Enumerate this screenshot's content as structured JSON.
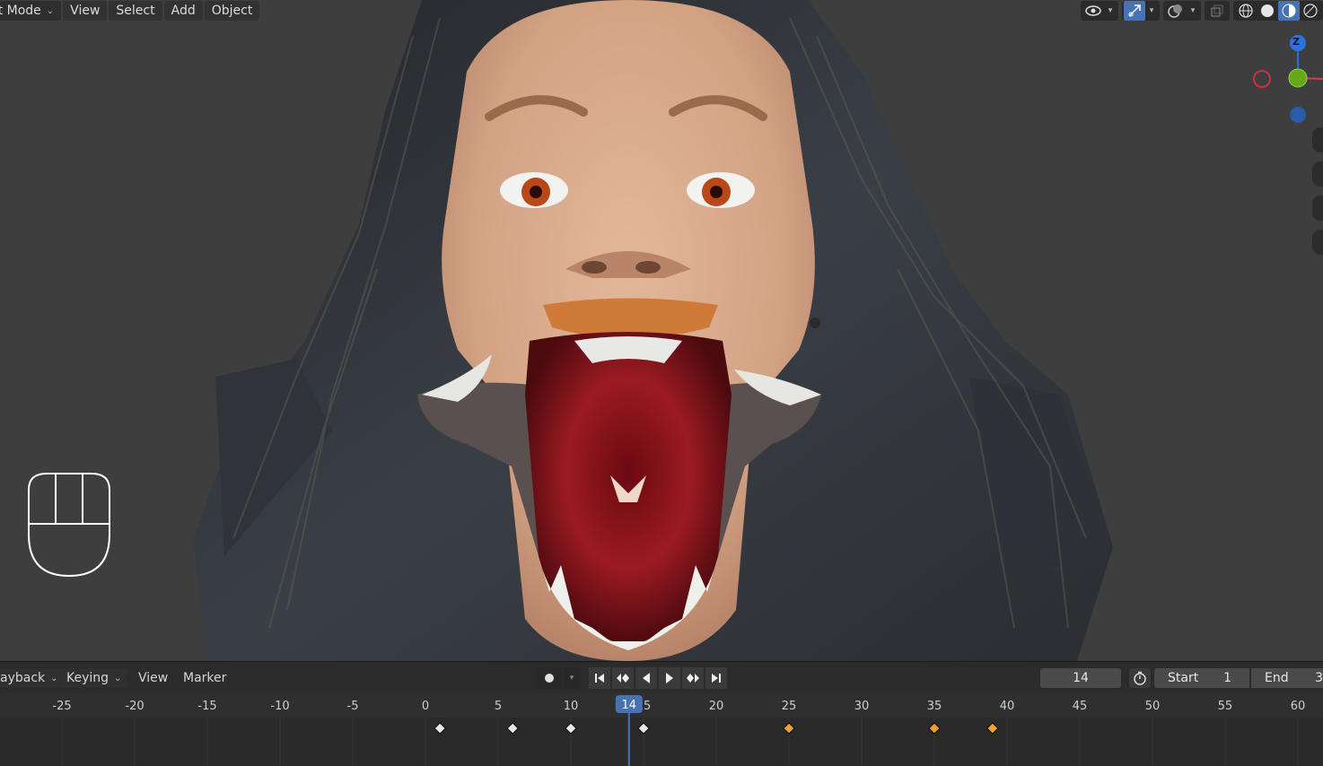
{
  "header": {
    "mode_label": "ct Mode",
    "menus": [
      "View",
      "Select",
      "Add",
      "Object"
    ]
  },
  "toolbar_icons": [
    "visibility-icon",
    "gizmo-toggle-icon",
    "overlay-icon",
    "xray-icon",
    "wireframe-shading-icon",
    "solid-shading-icon",
    "material-shading-icon",
    "rendered-shading-icon"
  ],
  "gizmo": {
    "z_label": "Z"
  },
  "timeline": {
    "menus": {
      "playback": "ayback",
      "keying": "Keying",
      "view": "View",
      "marker": "Marker"
    },
    "current_frame": "14",
    "current_frame_badge": "14",
    "start_label": "Start",
    "start_value": "1",
    "end_label": "End",
    "end_value": "3",
    "ruler_ticks": [
      "-25",
      "-20",
      "-15",
      "-10",
      "-5",
      "0",
      "5",
      "10",
      "15",
      "20",
      "25",
      "30",
      "35",
      "40",
      "45",
      "50",
      "55",
      "60"
    ],
    "keyframes": [
      {
        "frame": 1,
        "selected": false
      },
      {
        "frame": 6,
        "selected": false
      },
      {
        "frame": 10,
        "selected": false
      },
      {
        "frame": 15,
        "selected": false
      },
      {
        "frame": 25,
        "selected": true
      },
      {
        "frame": 35,
        "selected": true
      },
      {
        "frame": 39,
        "selected": true
      }
    ],
    "colors": {
      "accent": "#4772b3",
      "selected_key": "#f0a030",
      "key": "#e8e8e8"
    }
  }
}
